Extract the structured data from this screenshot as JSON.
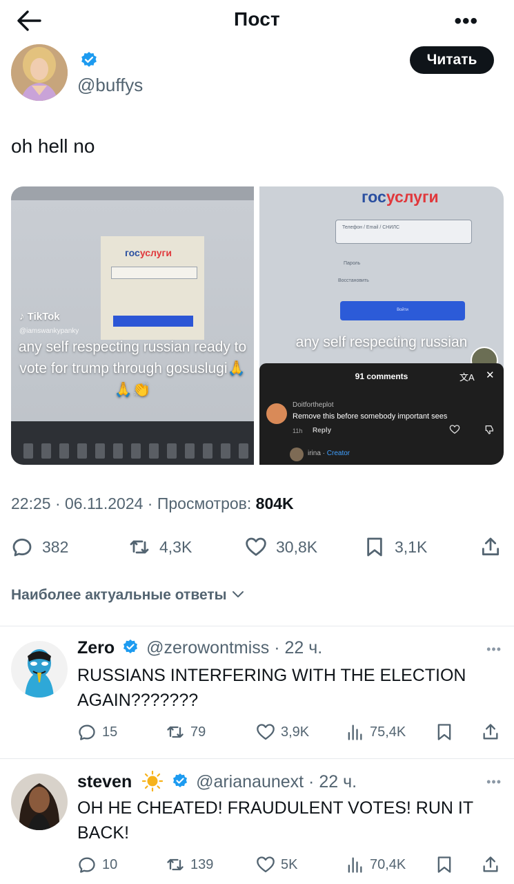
{
  "header": {
    "title": "Пост",
    "more": "•••"
  },
  "post": {
    "handle": "@buffys",
    "read_button": "Читать",
    "text": "oh hell no",
    "meta_time": "22:25 · 06.11.2024 · Просмотров: ",
    "meta_views": "804K",
    "stats": {
      "replies": "382",
      "reposts": "4,3K",
      "likes": "30,8K",
      "bookmarks": "3,1K"
    }
  },
  "media": {
    "left": {
      "logo_gos": "гос",
      "logo_uslugi": "услуги",
      "tiktok_label": "TikTok",
      "tiktok_user": "@iamswankypanky",
      "caption": "any self respecting russian ready to vote for trump through gosuslugi🙏🙏👏"
    },
    "right": {
      "logo_gos": "гос",
      "logo_uslugi": "услуги",
      "field_hint": "Телефон / Email / СНИЛС",
      "password_label": "Пароль",
      "restore_label": "Восстановить",
      "login_button": "Войти",
      "caption": "any self respecting russian",
      "comments_title": "91 comments",
      "comment1_user": "Doitfortheplot",
      "comment1_text": "Remove this before somebody important sees",
      "comment1_time": "11h",
      "comment1_reply": "Reply",
      "comment2_user": "irina · ",
      "comment2_creator": "Creator"
    }
  },
  "sort_label": "Наиболее актуальные ответы",
  "replies": [
    {
      "name": "Zero",
      "handle": "@zerowontmiss",
      "time": " · 22 ч.",
      "text": "RUSSIANS INTERFERING WITH THE ELECTION AGAIN???????",
      "replies": "15",
      "reposts": "79",
      "likes": "3,9K",
      "views": "75,4K"
    },
    {
      "name": "steven",
      "handle": "@arianaunext",
      "time": " · 22 ч.",
      "text": "OH HE CHEATED! FRAUDULENT VOTES! RUN IT BACK!",
      "replies": "10",
      "reposts": "139",
      "likes": "5K",
      "views": "70,4K"
    }
  ],
  "colors": {
    "accent": "#1d9bf0",
    "text": "#0f1419",
    "muted": "#536471",
    "gos_blue": "#2a4fa0",
    "gos_red": "#e0383c"
  }
}
